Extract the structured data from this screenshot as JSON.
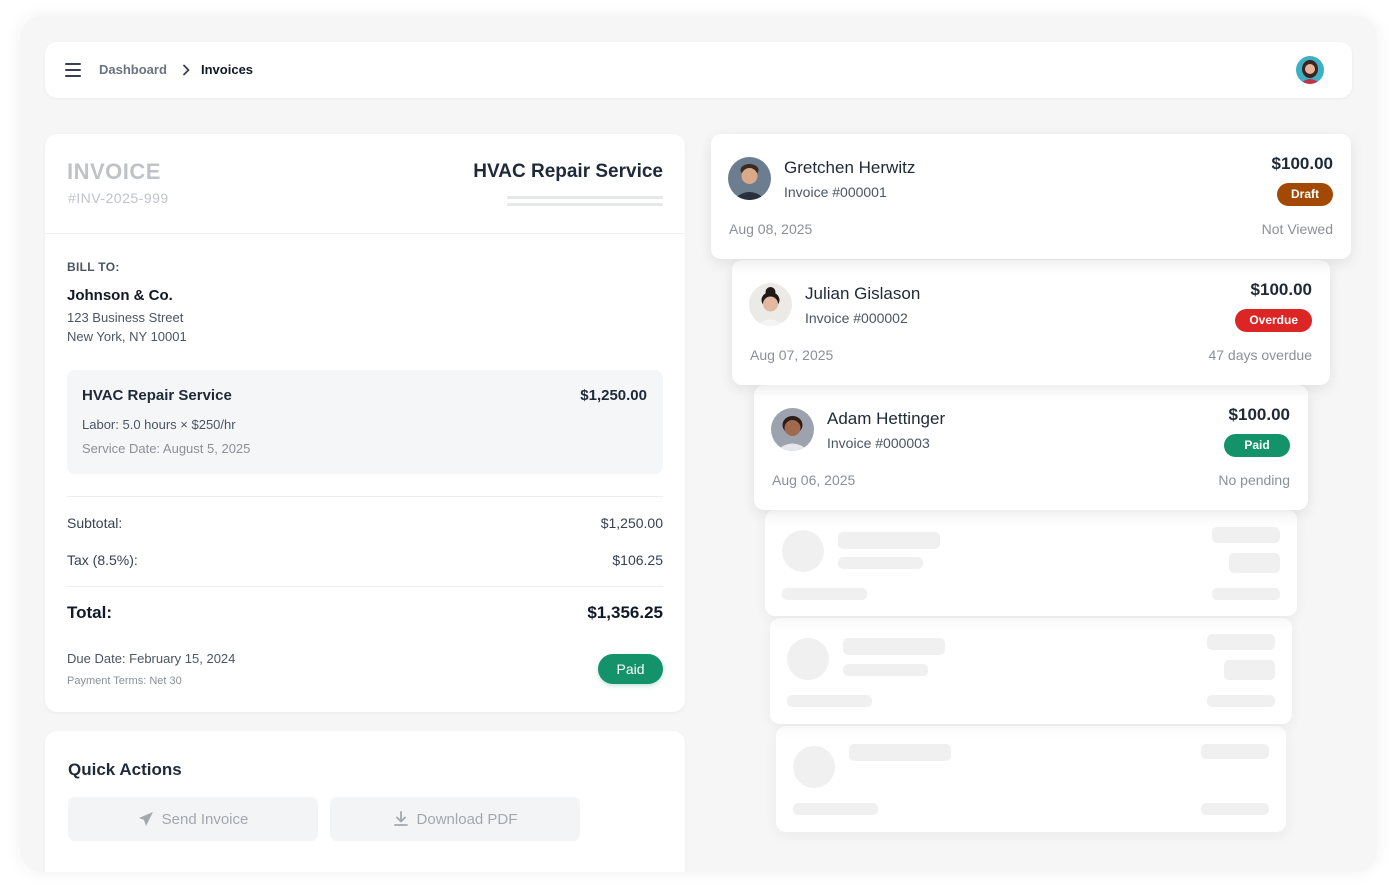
{
  "breadcrumb": {
    "parent": "Dashboard",
    "current": "Invoices"
  },
  "invoice": {
    "title": "INVOICE",
    "number": "#INV-2025-999",
    "service_title": "HVAC Repair Service",
    "bill_to_label": "BILL TO:",
    "bill_to_name": "Johnson & Co.",
    "address_line1": "123 Business Street",
    "address_line2": "New York, NY 10001",
    "item": {
      "name": "HVAC Repair Service",
      "amount": "$1,250.00",
      "labor": "Labor: 5.0 hours × $250/hr",
      "service_date": "Service Date: August 5, 2025"
    },
    "subtotal_label": "Subtotal:",
    "subtotal": "$1,250.00",
    "tax_label": "Tax (8.5%):",
    "tax": "$106.25",
    "total_label": "Total:",
    "total": "$1,356.25",
    "due_date": "Due Date: February 15, 2024",
    "payment_terms": "Payment Terms: Net 30",
    "status": "Paid"
  },
  "quick_actions": {
    "title": "Quick Actions",
    "send_label": "Send Invoice",
    "download_label": "Download PDF"
  },
  "invoice_list": [
    {
      "name": "Gretchen Herwitz",
      "invoice": "Invoice #000001",
      "amount": "$100.00",
      "badge": "Draft",
      "badge_color": "#a24a05",
      "date": "Aug 08, 2025",
      "status": "Not Viewed"
    },
    {
      "name": "Julian Gislason",
      "invoice": "Invoice #000002",
      "amount": "$100.00",
      "badge": "Overdue",
      "badge_color": "#dc2626",
      "date": "Aug 07, 2025",
      "status": "47 days overdue"
    },
    {
      "name": "Adam Hettinger",
      "invoice": "Invoice #000003",
      "amount": "$100.00",
      "badge": "Paid",
      "badge_color": "#14936a",
      "date": "Aug 06, 2025",
      "status": "No pending"
    }
  ],
  "icons": {
    "menu": "hamburger-menu-icon",
    "breadcrumb_separator": "chevron-right-icon",
    "send": "paper-plane-icon",
    "download": "download-icon"
  }
}
